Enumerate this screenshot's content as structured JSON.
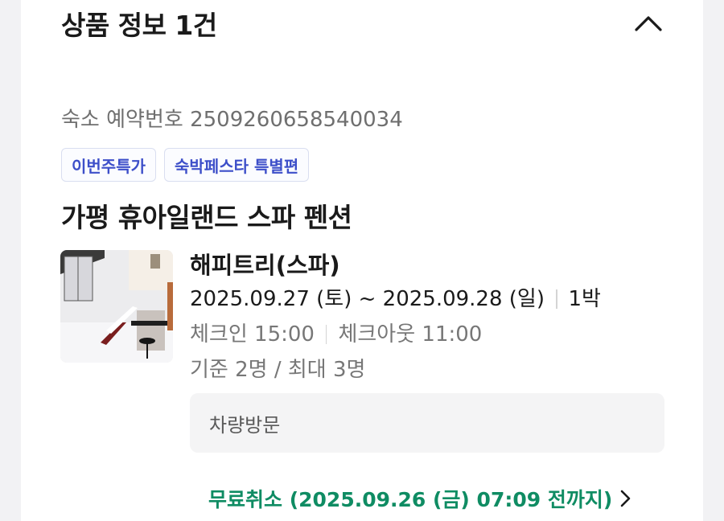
{
  "header": {
    "title": "상품 정보 1건",
    "collapse_icon": "chevron-up-icon"
  },
  "reservation": {
    "label": "숙소 예약번호",
    "number": "2509260658540034"
  },
  "tags": [
    "이번주특가",
    "숙박페스타 특별편"
  ],
  "property": {
    "name": "가평 휴아일랜드 스파 펜션"
  },
  "room": {
    "name": "해피트리(스파)",
    "dates": "2025.09.27 (토) ~ 2025.09.28 (일)",
    "nights": "1박",
    "checkin": "체크인 15:00",
    "checkout": "체크아웃 11:00",
    "capacity": "기준 2명 / 최대 3명",
    "image_icon": "room-photo"
  },
  "request_note": "차량방문",
  "cancel": {
    "text": "무료취소 (2025.09.26 (금) 07:09 전까지)",
    "icon": "chevron-right-icon"
  },
  "colors": {
    "tag_text": "#3d4fc9",
    "tag_border": "#d9def0",
    "cancel_green": "#0f8c63",
    "muted": "#777777"
  }
}
